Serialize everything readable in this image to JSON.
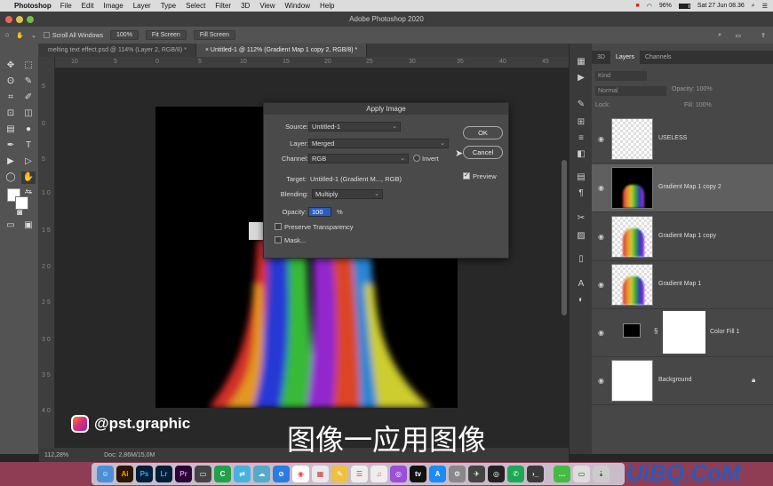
{
  "menubar": {
    "app": "Photoshop",
    "items": [
      "File",
      "Edit",
      "Image",
      "Layer",
      "Type",
      "Select",
      "Filter",
      "3D",
      "View",
      "Window",
      "Help"
    ],
    "battery": "96%",
    "clock": "Sat 27 Jun  08.36"
  },
  "window_title": "Adobe Photoshop 2020",
  "options": {
    "scroll_all": "Scroll All Windows",
    "zoom": "100%",
    "fit": "Fit Screen",
    "fill": "Fill Screen"
  },
  "tabs": [
    "melting text effect.psd @ 114% (Layer 2, RGB/8) *",
    "Untitled-1 @ 112% (Gradient Map 1 copy 2, RGB/8) *"
  ],
  "ruler_h": [
    "10",
    "5",
    "0",
    "5",
    "10",
    "15",
    "20",
    "25",
    "30",
    "35",
    "40",
    "45"
  ],
  "ruler_v": [
    "5",
    "0",
    "5",
    "1 0",
    "1 5",
    "2 0",
    "2 5",
    "3 0",
    "3 5",
    "4 0"
  ],
  "status": {
    "zoom": "112,28%",
    "doc": "Doc: 2,86M/15,0M"
  },
  "panel_tabs": [
    "3D",
    "Layers",
    "Channels"
  ],
  "panel_controls": {
    "kind": "Kind",
    "mode": "Normal",
    "opacity_label": "Opacity:",
    "opacity": "100%",
    "lock": "Lock:",
    "fill_label": "Fill:",
    "fill": "100%"
  },
  "layers": [
    {
      "name": "USELESS",
      "selected": false
    },
    {
      "name": "Gradient Map 1 copy 2",
      "selected": true
    },
    {
      "name": "Gradient Map 1 copy",
      "selected": false
    },
    {
      "name": "Gradient Map 1",
      "selected": false
    },
    {
      "name": "Color Fill 1",
      "selected": false
    },
    {
      "name": "Background",
      "selected": false
    }
  ],
  "dialog": {
    "title": "Apply Image",
    "source_label": "Source:",
    "source": "Untitled-1",
    "layer_label": "Layer:",
    "layer": "Merged",
    "channel_label": "Channel:",
    "channel": "RGB",
    "invert": "Invert",
    "target_label": "Target:",
    "target": "Untitled-1 (Gradient M..., RGB)",
    "blending_label": "Blending:",
    "blending": "Multiply",
    "opacity_label": "Opacity:",
    "opacity": "100",
    "pct": "%",
    "preserve": "Preserve Transparency",
    "mask": "Mask...",
    "ok": "OK",
    "cancel": "Cancel",
    "preview": "Preview"
  },
  "brand": "@pst.graphic",
  "subtitle": "图像一应用图像",
  "watermark": "UiBQ.CoM",
  "dock": [
    "Ai",
    "Ps",
    "Lr",
    "Pr",
    "C"
  ]
}
